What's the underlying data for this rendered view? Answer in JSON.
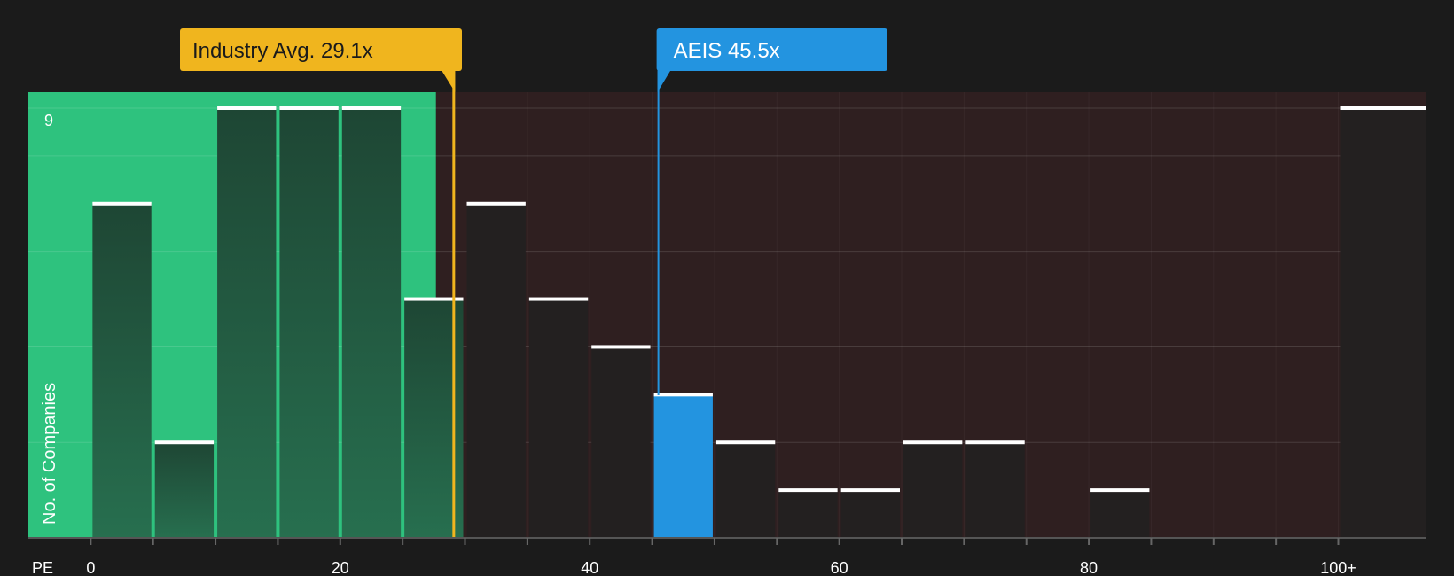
{
  "chart_data": {
    "type": "bar",
    "title": "",
    "xlabel": "PE",
    "ylabel": "No. of Companies",
    "xlim": [
      -5,
      107
    ],
    "ylim": [
      0,
      9
    ],
    "bin_width": 5,
    "x_ticks": [
      {
        "value": 0,
        "label": "0"
      },
      {
        "value": 20,
        "label": "20"
      },
      {
        "value": 40,
        "label": "40"
      },
      {
        "value": 60,
        "label": "60"
      },
      {
        "value": 80,
        "label": "80"
      },
      {
        "value": 100,
        "label": "100+"
      }
    ],
    "y_ticks": [
      {
        "value": 9,
        "label": "9"
      }
    ],
    "bins": [
      {
        "start": 0,
        "count": 7
      },
      {
        "start": 5,
        "count": 2
      },
      {
        "start": 10,
        "count": 9
      },
      {
        "start": 15,
        "count": 9
      },
      {
        "start": 20,
        "count": 9
      },
      {
        "start": 25,
        "count": 5
      },
      {
        "start": 30,
        "count": 7
      },
      {
        "start": 35,
        "count": 5
      },
      {
        "start": 40,
        "count": 4
      },
      {
        "start": 45,
        "count": 3,
        "highlight": true
      },
      {
        "start": 50,
        "count": 2
      },
      {
        "start": 55,
        "count": 1
      },
      {
        "start": 60,
        "count": 1
      },
      {
        "start": 65,
        "count": 2
      },
      {
        "start": 70,
        "count": 2
      },
      {
        "start": 80,
        "count": 1
      },
      {
        "start": 100,
        "count": 9
      }
    ],
    "markers": [
      {
        "name": "industry",
        "value": 29.1,
        "label": "Industry Avg. 29.1x",
        "color": "#f0b51e"
      },
      {
        "name": "company",
        "value": 45.5,
        "label": "AEIS 45.5x",
        "color": "#2394e0"
      }
    ],
    "colors": {
      "below_zone": "#2ec27e",
      "above_zone": "#2f1f20",
      "bar_in_zone": "#1f4a36",
      "bar_out_zone": "#232020",
      "highlight_bar": "#2394e0",
      "bar_top": "#ffffff",
      "background": "#1b1b1b"
    }
  }
}
